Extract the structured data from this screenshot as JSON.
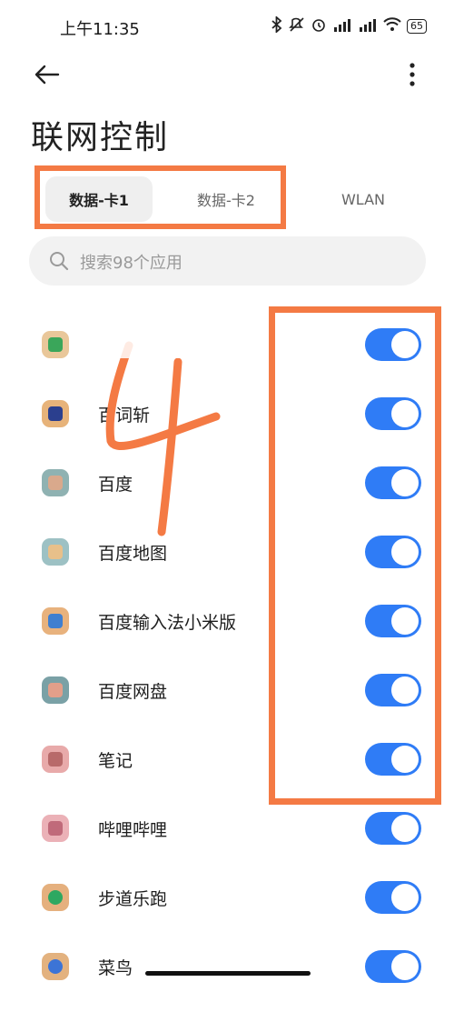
{
  "status_bar": {
    "time": "上午11:35",
    "icons": [
      "bluetooth-icon",
      "mute-icon",
      "alarm-icon",
      "signal-hd-icon",
      "signal-hd-icon",
      "wifi-icon"
    ],
    "battery": "65"
  },
  "header": {
    "title": "联网控制",
    "back_icon": "arrow-left-icon",
    "more_icon": "more-vertical-icon"
  },
  "tabs": [
    {
      "label": "数据-卡1",
      "selected": true
    },
    {
      "label": "数据-卡2",
      "selected": false
    },
    {
      "label": "WLAN",
      "selected": false
    }
  ],
  "search": {
    "placeholder": "搜索98个应用"
  },
  "apps": [
    {
      "name": "",
      "icon_color": "#3aa65a",
      "toggle": true
    },
    {
      "name": "百词斩",
      "icon_color": "#2b3f8e",
      "toggle": true
    },
    {
      "name": "百度",
      "icon_color": "#7fa5a5",
      "toggle": true
    },
    {
      "name": "百度地图",
      "icon_color": "#8fb4b8",
      "toggle": true
    },
    {
      "name": "百度输入法小米版",
      "icon_color": "#3f7fd0",
      "toggle": true
    },
    {
      "name": "百度网盘",
      "icon_color": "#7aa1a6",
      "toggle": true
    },
    {
      "name": "笔记",
      "icon_color": "#e3a3a3",
      "toggle": true
    },
    {
      "name": "哔哩哔哩",
      "icon_color": "#e7a9b0",
      "toggle": true
    },
    {
      "name": "步道乐跑",
      "icon_color": "#2ea861",
      "toggle": true
    },
    {
      "name": "菜鸟",
      "icon_color": "#3c74d6",
      "toggle": true
    }
  ],
  "colors": {
    "accent": "#2f7cf6",
    "annotation": "#f47a44"
  }
}
